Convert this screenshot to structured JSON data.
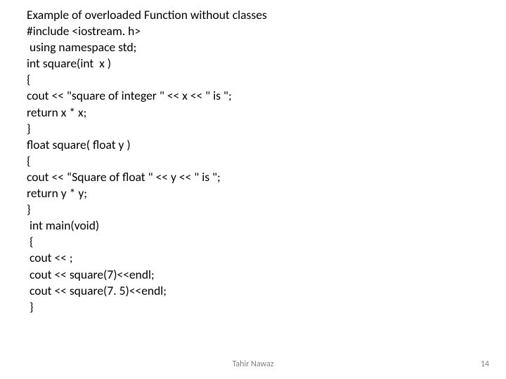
{
  "lines": [
    "Example of overloaded Function without classes",
    "#include <iostream. h>",
    " using namespace std;",
    "int square(int  x )",
    "{",
    "cout << \"square of integer \" << x << \" is \";",
    "return x * x;",
    "}",
    "float square( float y )",
    "{",
    "cout << “Square of float \" << y << \" is \";",
    "return y * y;",
    "}",
    " int main(void)",
    " {",
    " cout << ;",
    " cout << square(7)<<endl;",
    " cout << square(7. 5)<<endl;",
    " }"
  ],
  "footer": {
    "author": "Tahir Nawaz",
    "page": "14"
  }
}
